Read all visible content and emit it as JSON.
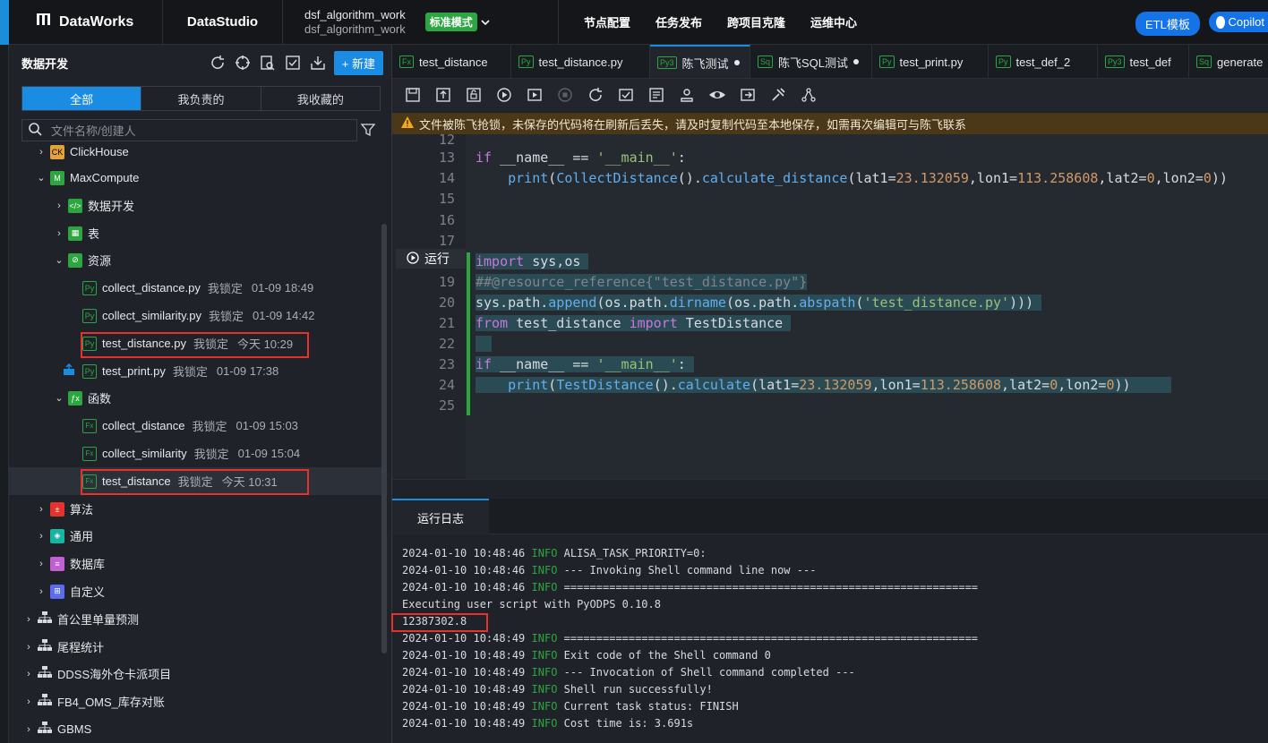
{
  "topbar": {
    "brand": "DataWorks",
    "studio": "DataStudio",
    "workspace_line1": "dsf_algorithm_work",
    "workspace_line2": "dsf_algorithm_work",
    "mode": "标准模式",
    "menu": [
      "节点配置",
      "任务发布",
      "跨项目克隆",
      "运维中心"
    ],
    "etl_button": "ETL模板",
    "copilot_button": "Copilot"
  },
  "sidebar": {
    "title": "数据开发",
    "new_button": "+ 新建",
    "tabs": [
      "全部",
      "我负责的",
      "我收藏的"
    ],
    "search_placeholder": "文件名称/创建人",
    "tree": [
      {
        "label": "ClickHouse"
      },
      {
        "label": "MaxCompute"
      },
      {
        "label": "数据开发"
      },
      {
        "label": "表"
      },
      {
        "label": "资源"
      },
      {
        "label": "collect_distance.py",
        "lock": "我锁定",
        "time": "01-09 18:49"
      },
      {
        "label": "collect_similarity.py",
        "lock": "我锁定",
        "time": "01-09 14:42"
      },
      {
        "label": "test_distance.py",
        "lock": "我锁定",
        "time": "今天 10:29"
      },
      {
        "label": "test_print.py",
        "lock": "我锁定",
        "time": "01-09 17:38"
      },
      {
        "label": "函数"
      },
      {
        "label": "collect_distance",
        "lock": "我锁定",
        "time": "01-09 15:03"
      },
      {
        "label": "collect_similarity",
        "lock": "我锁定",
        "time": "01-09 15:04"
      },
      {
        "label": "test_distance",
        "lock": "我锁定",
        "time": "今天 10:31"
      },
      {
        "label": "算法"
      },
      {
        "label": "通用"
      },
      {
        "label": "数据库"
      },
      {
        "label": "自定义"
      },
      {
        "label": "首公里单量预测"
      },
      {
        "label": "尾程统计"
      },
      {
        "label": "DDSS海外仓卡派项目"
      },
      {
        "label": "FB4_OMS_库存对账"
      },
      {
        "label": "GBMS"
      }
    ]
  },
  "editor_tabs": [
    {
      "badge": "Fx",
      "label": "test_distance"
    },
    {
      "badge": "Py",
      "label": "test_distance.py"
    },
    {
      "badge": "Py3",
      "label": "陈飞测试"
    },
    {
      "badge": "Sq",
      "label": "陈飞SQL测试"
    },
    {
      "badge": "Py",
      "label": "test_print.py"
    },
    {
      "badge": "Py",
      "label": "test_def_2"
    },
    {
      "badge": "Py3",
      "label": "test_def"
    },
    {
      "badge": "Sq",
      "label": "generate"
    }
  ],
  "warning": "文件被陈飞抢锁，未保存的代码将在刷新后丢失，请及时复制代码至本地保存，如需再次编辑可与陈飞联系",
  "editor": {
    "run_label": "运行",
    "line_numbers": [
      "12",
      "13",
      "14",
      "15",
      "16",
      "17",
      "18",
      "19",
      "20",
      "21",
      "22",
      "23",
      "24",
      "25"
    ]
  },
  "log": {
    "tab": "运行日志",
    "lines": [
      {
        "ts": "2024-01-10 10:48:46",
        "level": "INFO",
        "msg": "ALISA_TASK_PRIORITY=0:"
      },
      {
        "ts": "2024-01-10 10:48:46",
        "level": "INFO",
        "msg": "--- Invoking Shell command line now ---"
      },
      {
        "ts": "2024-01-10 10:48:46",
        "level": "INFO",
        "msg": "================================================================"
      },
      {
        "ts": "",
        "level": "",
        "msg": "Executing user script with PyODPS 0.10.8"
      },
      {
        "ts": "",
        "level": "",
        "msg": "12387302.8"
      },
      {
        "ts": "2024-01-10 10:48:49",
        "level": "INFO",
        "msg": "================================================================"
      },
      {
        "ts": "2024-01-10 10:48:49",
        "level": "INFO",
        "msg": "Exit code of the Shell command 0"
      },
      {
        "ts": "2024-01-10 10:48:49",
        "level": "INFO",
        "msg": "--- Invocation of Shell command completed ---"
      },
      {
        "ts": "2024-01-10 10:48:49",
        "level": "INFO",
        "msg": "Shell run successfully!"
      },
      {
        "ts": "2024-01-10 10:48:49",
        "level": "INFO",
        "msg": "Current task status: FINISH"
      },
      {
        "ts": "2024-01-10 10:48:49",
        "level": "INFO",
        "msg": "Cost time is: 3.691s"
      }
    ]
  }
}
